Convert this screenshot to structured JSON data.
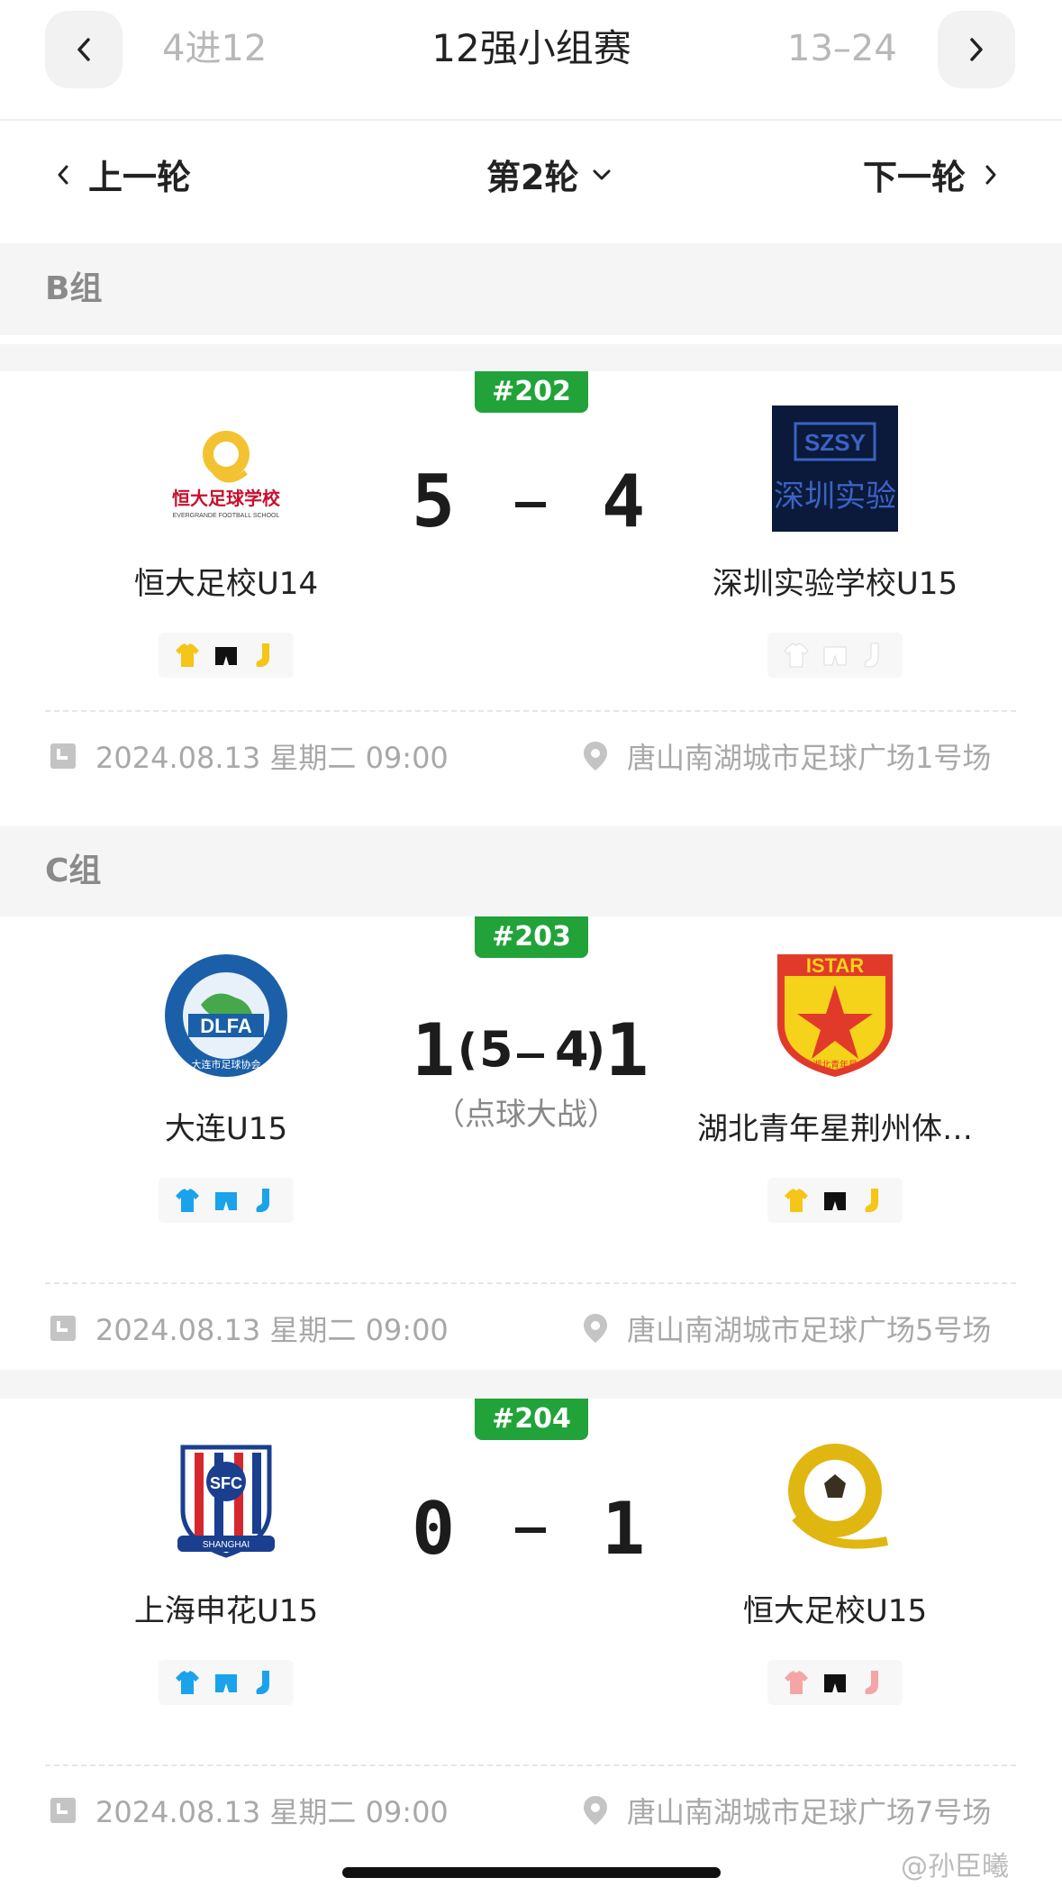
{
  "stage": {
    "prev_label": "4进12",
    "current_label": "12强小组赛",
    "next_label": "13–24"
  },
  "round": {
    "prev_label": "上一轮",
    "current_label": "第2轮",
    "next_label": "下一轮"
  },
  "groups": [
    {
      "label": "B组"
    },
    {
      "label": "C组"
    }
  ],
  "matches": [
    {
      "number": "#202",
      "home": {
        "name": "恒大足校U14",
        "logo_text": "恒大足球学校",
        "logo_sub": "EVERGRANDE FOOTBALL SCHOOL",
        "kit": [
          "#f5c518",
          "#111111",
          "#f5c518"
        ]
      },
      "away": {
        "name": "深圳实验学校U15",
        "logo_text": "SZSY",
        "logo_sub": "深圳实验",
        "kit": [
          "#ffffff",
          "#ffffff",
          "#ffffff"
        ]
      },
      "home_score": "5",
      "away_score": "4",
      "datetime": "2024.08.13 星期二 09:00",
      "venue": "唐山南湖城市足球广场1号场"
    },
    {
      "number": "#203",
      "home": {
        "name": "大连U15",
        "logo_text": "DLFA",
        "logo_sub": "大连市足球协会",
        "kit": [
          "#1aa3ea",
          "#1aa3ea",
          "#1aa3ea"
        ]
      },
      "away": {
        "name": "湖北青年星荆州体…",
        "logo_text": "ISTAR",
        "logo_sub": "湖北青年星",
        "kit": [
          "#f5c518",
          "#111111",
          "#f5c518"
        ]
      },
      "home_score": "1",
      "away_score": "1",
      "pen_home": "5",
      "pen_away": "4",
      "pen_note": "（点球大战）",
      "datetime": "2024.08.13 星期二 09:00",
      "venue": "唐山南湖城市足球广场5号场"
    },
    {
      "number": "#204",
      "home": {
        "name": "上海申花U15",
        "logo_text": "SFC",
        "logo_sub": "SHANGHAI",
        "kit": [
          "#1aa3ea",
          "#1aa3ea",
          "#1aa3ea"
        ]
      },
      "away": {
        "name": "恒大足校U15",
        "logo_text": "",
        "logo_sub": "",
        "kit": [
          "#f4a5a5",
          "#111111",
          "#f4a5a5"
        ]
      },
      "home_score": "0",
      "away_score": "1",
      "datetime": "2024.08.13 星期二 09:00",
      "venue": "唐山南湖城市足球广场7号场"
    }
  ],
  "watermark": "@孙臣曦"
}
